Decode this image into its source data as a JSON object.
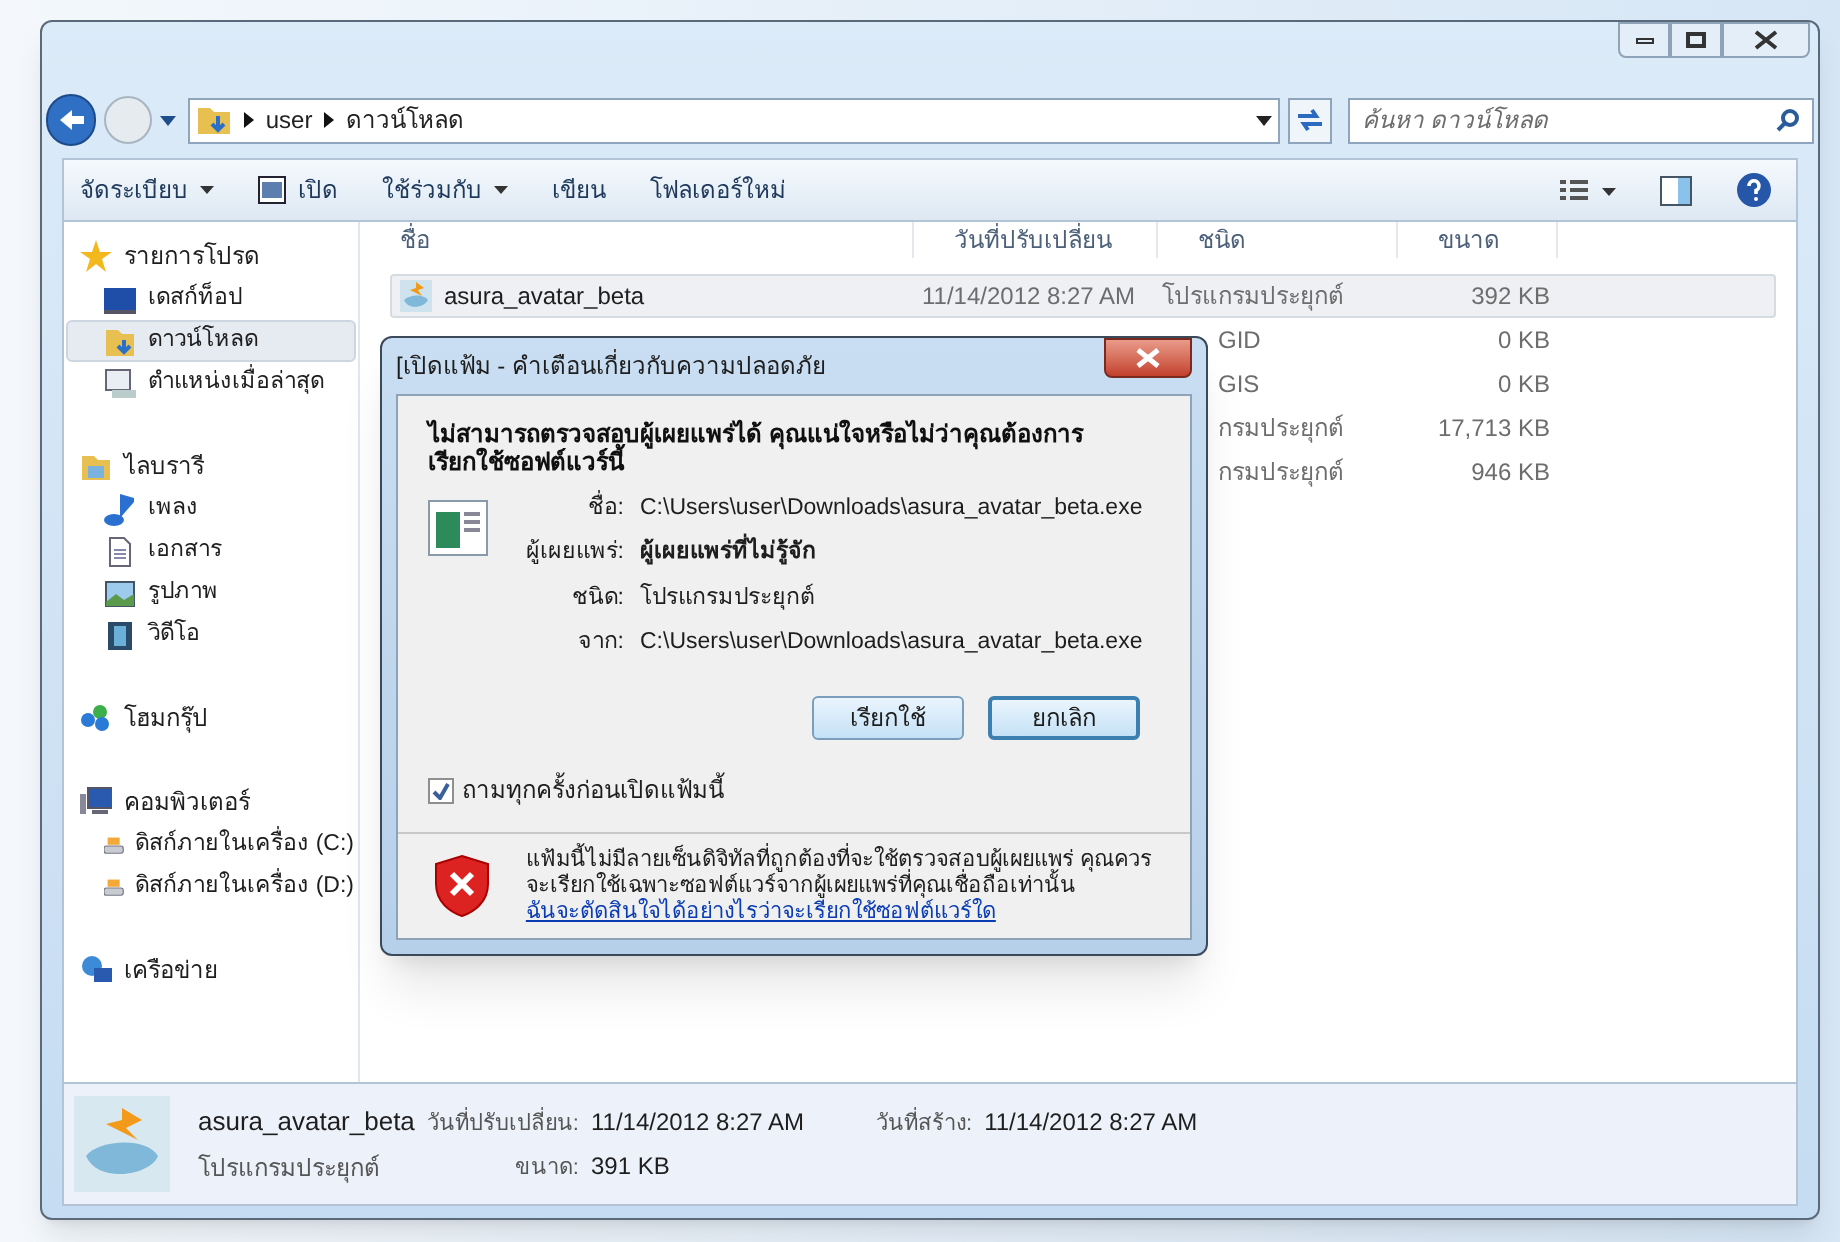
{
  "address_bar": {
    "segments": [
      "user",
      "ดาวน์โหลด"
    ]
  },
  "search": {
    "placeholder": "ค้นหา ดาวน์โหลด"
  },
  "toolbar": {
    "buttons": [
      {
        "label": "จัดระเบียบ",
        "dropdown": true
      },
      {
        "label": "เปิด",
        "dropdown": false
      },
      {
        "label": "ใช้ร่วมกับ",
        "dropdown": true
      },
      {
        "label": "เขียน",
        "dropdown": false
      },
      {
        "label": "โฟลเดอร์ใหม่",
        "dropdown": false
      }
    ]
  },
  "sidebar": {
    "groups": [
      {
        "label": "รายการโปรด",
        "children": [
          {
            "label": "เดสก์ท็อป",
            "selected": false
          },
          {
            "label": "ดาวน์โหลด",
            "selected": true
          },
          {
            "label": "ตำแหน่งเมื่อล่าสุด",
            "selected": false
          }
        ]
      },
      {
        "label": "ไลบรารี",
        "children": [
          {
            "label": "เพลง",
            "selected": false
          },
          {
            "label": "เอกสาร",
            "selected": false
          },
          {
            "label": "รูปภาพ",
            "selected": false
          },
          {
            "label": "วิดีโอ",
            "selected": false
          }
        ]
      },
      {
        "label": "โฮมกรุ๊ป"
      },
      {
        "label": "คอมพิวเตอร์",
        "children": [
          {
            "label": "ดิสก์ภายในเครื่อง (C:)",
            "selected": false
          },
          {
            "label": "ดิสก์ภายในเครื่อง (D:)",
            "selected": false
          }
        ]
      },
      {
        "label": "เครือข่าย"
      }
    ]
  },
  "table": {
    "columns": [
      "ชื่อ",
      "วันที่ปรับเปลี่ยน",
      "ชนิด",
      "ขนาด"
    ],
    "rows": [
      {
        "kind": "full",
        "name": "asura_avatar_beta",
        "date": "11/14/2012 8:27 AM",
        "type": "โปรแกรมประยุกต์",
        "size": "392 KB",
        "selected": true
      },
      {
        "kind": "covered",
        "type": "GID",
        "size": "0 KB",
        "selected": false
      },
      {
        "kind": "covered",
        "type": "GIS",
        "size": "0 KB",
        "selected": false
      },
      {
        "kind": "covered",
        "type": "กรมประยุกต์",
        "size": "17,713 KB",
        "selected": false
      },
      {
        "kind": "covered",
        "type": "กรมประยุกต์",
        "size": "946 KB",
        "selected": false
      }
    ]
  },
  "dialog": {
    "title": "[เปิดแฟ้ม - คำเตือนเกี่ยวกับความปลอดภัย",
    "heading": "ไม่สามารถตรวจสอบผู้เผยแพร่ได้  คุณแน่ใจหรือไม่ว่าคุณต้องการเรียกใช้ซอฟต์แวร์นี้",
    "fields": [
      {
        "label": "ชื่อ:",
        "value": "C:\\Users\\user\\Downloads\\asura_avatar_beta.exe",
        "bold": false
      },
      {
        "label": "ผู้เผยแพร่:",
        "value": "ผู้เผยแพร่ที่ไม่รู้จัก",
        "bold": true
      },
      {
        "label": "ชนิด:",
        "value": "โปรแกรมประยุกต์",
        "bold": false
      },
      {
        "label": "จาก:",
        "value": "C:\\Users\\user\\Downloads\\asura_avatar_beta.exe",
        "bold": false
      }
    ],
    "buttons": [
      "เรียกใช้",
      "ยกเลิก"
    ],
    "checkbox": {
      "label": "ถามทุกครั้งก่อนเปิดแฟ้มนี้",
      "checked": true
    },
    "warning": {
      "text": "แฟ้มนี้ไม่มีลายเซ็นดิจิทัลที่ถูกต้องที่จะใช้ตรวจสอบผู้เผยแพร่ คุณควรจะเรียกใช้เฉพาะซอฟต์แวร์จากผู้เผยแพร่ที่คุณเชื่อถือเท่านั้น",
      "link": "ฉันจะตัดสินใจได้อย่างไรว่าจะเรียกใช้ซอฟต์แวร์ใด"
    }
  },
  "details_pane": {
    "name": "asura_avatar_beta",
    "type": "โปรแกรมประยุกต์",
    "fields": [
      {
        "label": "วันที่ปรับเปลี่ยน:",
        "value": "11/14/2012 8:27 AM"
      },
      {
        "label": "ขนาด:",
        "value": "391 KB"
      },
      {
        "label": "วันที่สร้าง:",
        "value": "11/14/2012 8:27 AM"
      }
    ]
  }
}
